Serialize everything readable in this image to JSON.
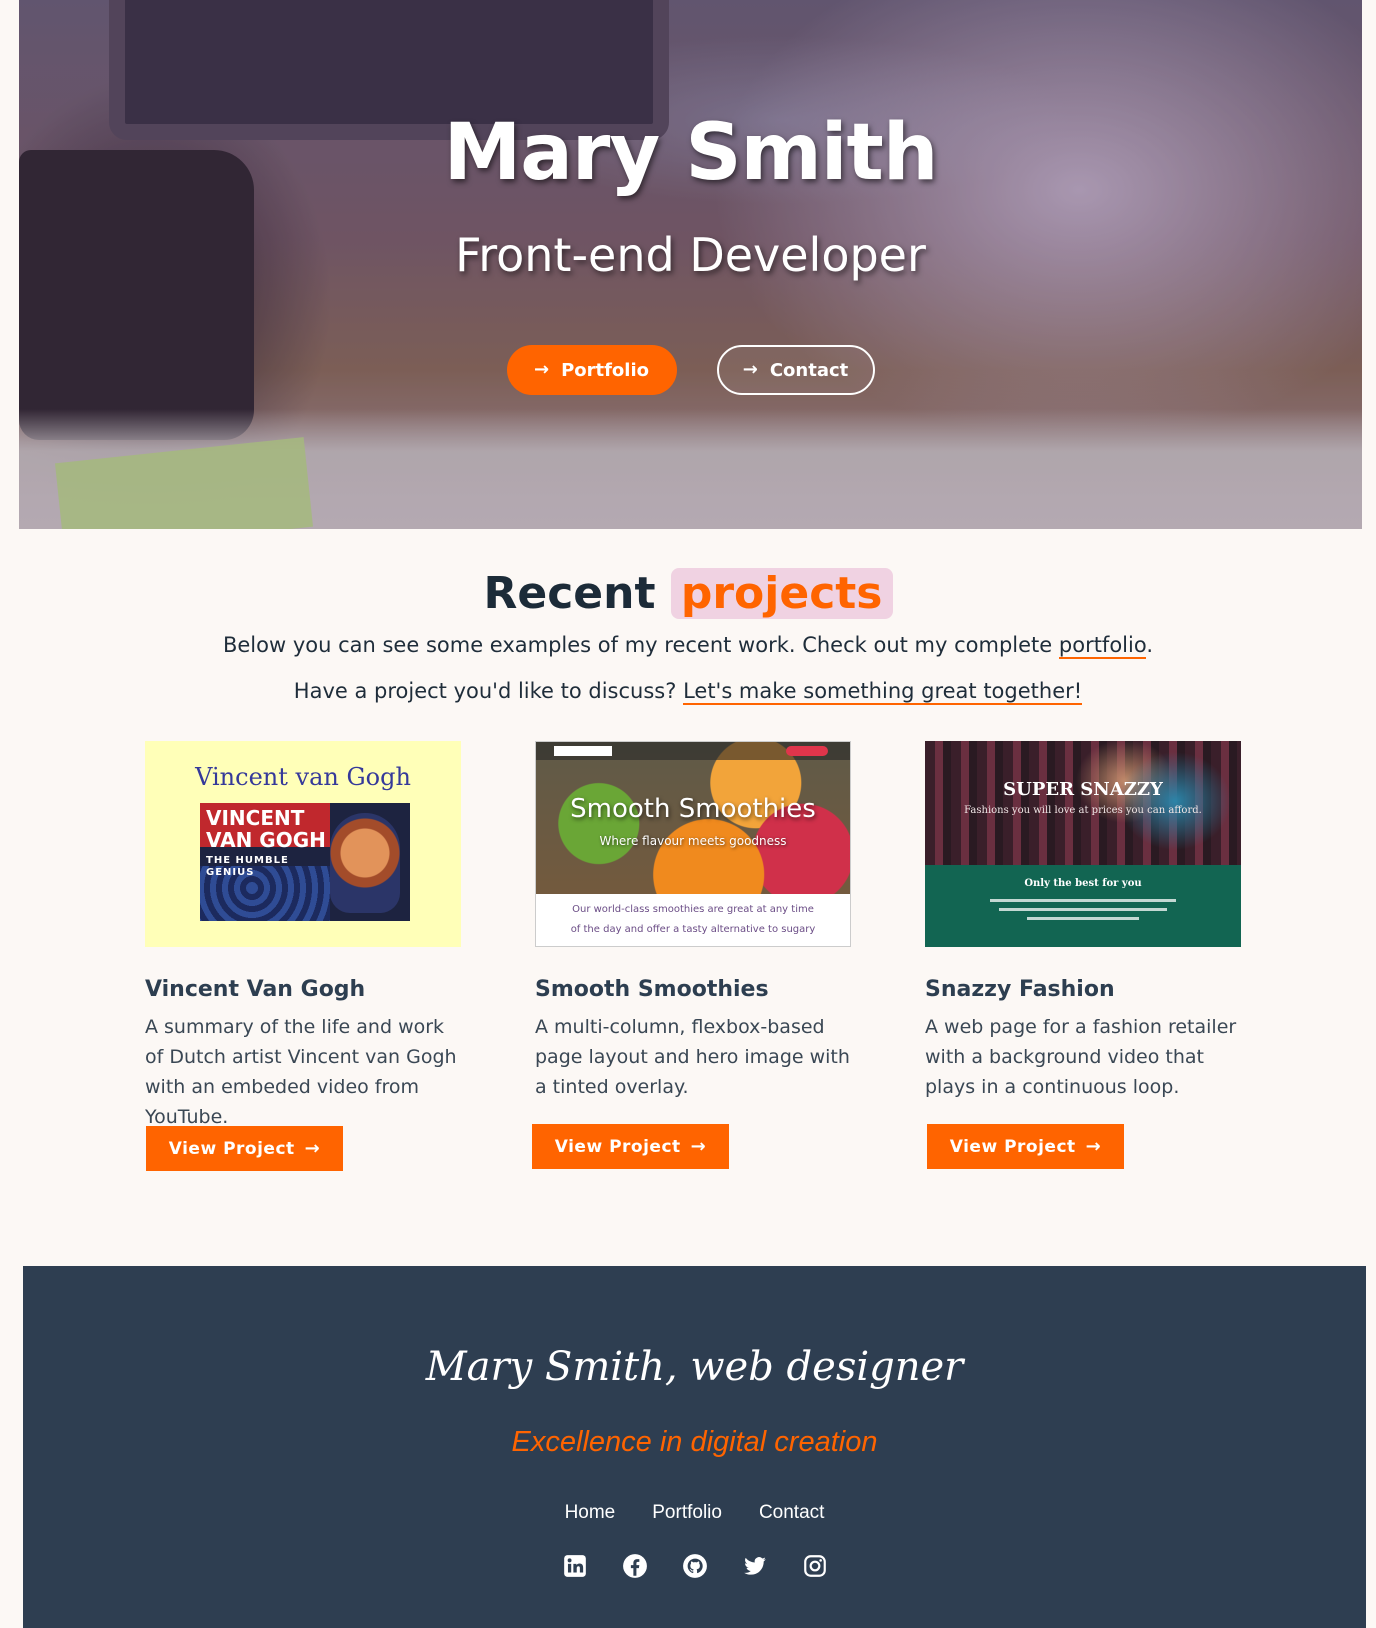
{
  "hero": {
    "name": "Mary Smith",
    "role": "Front-end Developer",
    "portfolio_button": "Portfolio",
    "contact_button": "Contact"
  },
  "projects": {
    "title_plain": "Recent",
    "title_highlight": "projects",
    "intro_text": "Below you can see some examples of my recent work. Check out my complete",
    "intro_link": "portfolio",
    "intro_end": ".",
    "discuss_text": "Have a project you'd like to discuss?",
    "discuss_link": "Let's make something great together!",
    "items": [
      {
        "title": "Vincent Van Gogh",
        "description": "A summary of the life and work of Dutch artist Vincent van Gogh with an embeded video from YouTube.",
        "button": "View Project",
        "thumb_title": "Vincent van Gogh",
        "thumb_poster_line1": "VINCENT",
        "thumb_poster_line2": "VAN GOGH",
        "thumb_poster_sub1": "THE HUMBLE",
        "thumb_poster_sub2": "GENIUS"
      },
      {
        "title": "Smooth Smoothies",
        "description": "A multi-column, flexbox-based page layout and hero image with a tinted overlay.",
        "button": "View Project",
        "thumb_title": "Smooth Smoothies",
        "thumb_tagline": "Where flavour meets goodness",
        "thumb_text1": "Our world-class smoothies are great at any time",
        "thumb_text2": "of the day and offer a tasty alternative to sugary"
      },
      {
        "title": "Snazzy Fashion",
        "description": "A web page for a fashion retailer with a background video that plays in a continuous loop.",
        "button": "View Project",
        "thumb_title": "SUPER SNAZZY",
        "thumb_tagline": "Fashions you will love at prices you can afford.",
        "thumb_heading": "Only the best for you"
      }
    ]
  },
  "footer": {
    "name": "Mary Smith, web designer",
    "tagline": "Excellence in digital creation",
    "nav": [
      "Home",
      "Portfolio",
      "Contact"
    ],
    "social_icons": [
      "linkedin-icon",
      "facebook-icon",
      "github-icon",
      "twitter-icon",
      "instagram-icon"
    ]
  },
  "colors": {
    "accent": "#ff6400",
    "footer_bg": "#2e3e51",
    "page_bg": "#fcf8f5",
    "highlight_bg": "#f0d2e2"
  }
}
